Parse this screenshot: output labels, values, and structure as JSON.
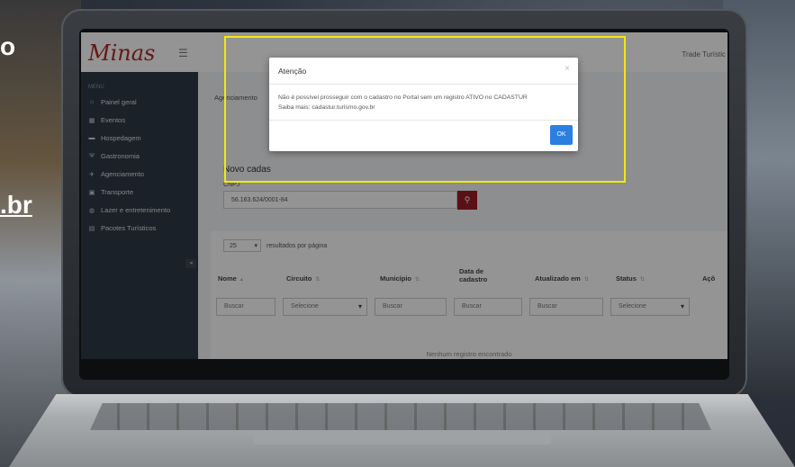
{
  "background": {
    "edge_text_top": "o",
    "edge_text_mid": ".br"
  },
  "app": {
    "logo_text": "Minas",
    "top_right_text": "Trade Turístic"
  },
  "sidebar": {
    "menu_label": "MENU",
    "items": [
      {
        "label": "Painel geral",
        "icon": "home-icon"
      },
      {
        "label": "Eventos",
        "icon": "calendar-icon"
      },
      {
        "label": "Hospedagem",
        "icon": "bed-icon"
      },
      {
        "label": "Gastronomia",
        "icon": "utensils-icon"
      },
      {
        "label": "Agenciamento",
        "icon": "plane-icon"
      },
      {
        "label": "Transporte",
        "icon": "bus-icon"
      },
      {
        "label": "Lazer e entretenimento",
        "icon": "globe-icon"
      },
      {
        "label": "Pacotes Turísticos",
        "icon": "suitcase-icon"
      }
    ]
  },
  "main": {
    "breadcrumb": "Agenciamento",
    "section_title": "Novo cadas",
    "cnpj_label": "CNPJ",
    "cnpj_value": "56.163.624/0001-84",
    "per_page_value": "25",
    "per_page_label": "resultados por página",
    "columns": [
      "Nome",
      "Circuito",
      "Município",
      "Data de\ncadastro",
      "Atualizado em",
      "Status",
      "Açõ"
    ],
    "filters": {
      "nome": "Buscar",
      "circuito": "Selecione",
      "municipio": "Buscar",
      "data_cadastro": "Buscar",
      "atualizado": "Buscar",
      "status": "Selecione"
    },
    "empty_message": "Nenhum registro encontrado"
  },
  "modal": {
    "title": "Atenção",
    "close_glyph": "×",
    "line1": "Não é possível prosseguir com o cadastro no Portal sem um registro ATIVO no CADASTUR",
    "line2": "Saiba mais: cadastur.turismo.gov.br",
    "ok_label": "OK"
  },
  "colors": {
    "brand_red": "#9e1c25",
    "sidebar_bg": "#2f3a45",
    "ok_blue": "#2a7fe0",
    "highlight": "#f2e80e"
  }
}
